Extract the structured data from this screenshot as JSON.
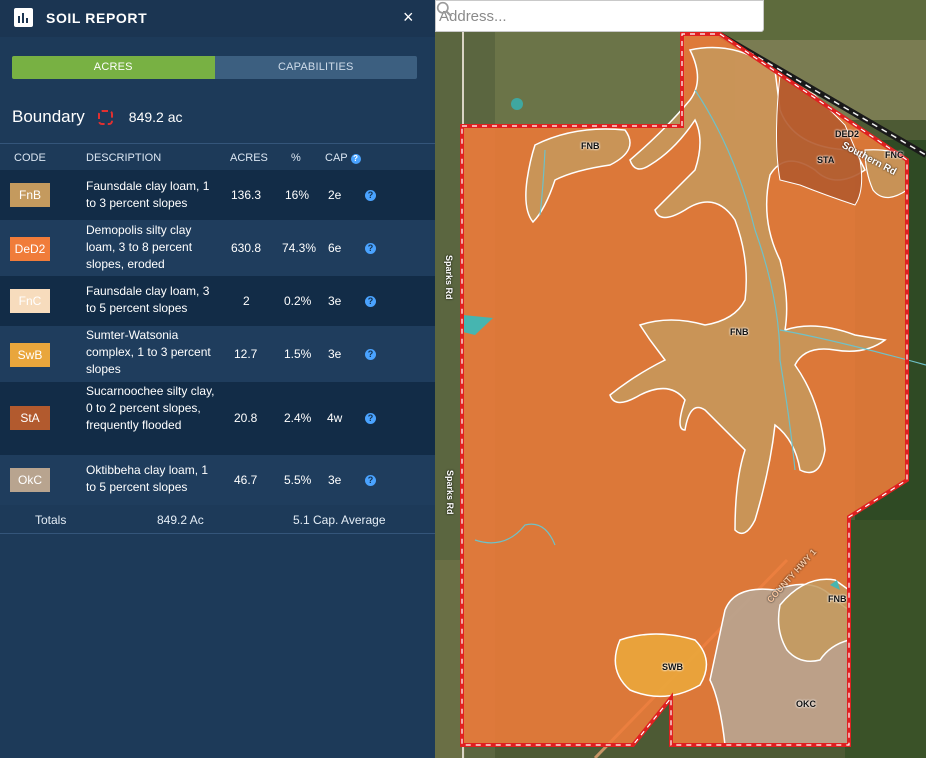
{
  "panel": {
    "title": "SOIL REPORT",
    "close": "×",
    "tabs": [
      {
        "label": "ACRES",
        "active": true
      },
      {
        "label": "CAPABILITIES",
        "active": false
      }
    ],
    "boundary": {
      "label": "Boundary",
      "acres": "849.2 ac"
    },
    "columns": {
      "code": "CODE",
      "description": "DESCRIPTION",
      "acres": "ACRES",
      "percent": "%",
      "cap": "CAP",
      "cap_info": "?"
    },
    "rows": [
      {
        "code": "FnB",
        "color": "#c49a5e",
        "description": "Faunsdale clay loam, 1 to 3 percent slopes",
        "acres": "136.3",
        "percent": "16%",
        "cap": "2e",
        "info": "?"
      },
      {
        "code": "DeD2",
        "color": "#f07c3a",
        "description": "Demopolis silty clay loam, 3 to 8 percent slopes, eroded",
        "acres": "630.8",
        "percent": "74.3%",
        "cap": "6e",
        "info": "?"
      },
      {
        "code": "FnC",
        "color": "#f7dcbd",
        "description": "Faunsdale clay loam, 3 to 5 percent slopes",
        "acres": "2",
        "percent": "0.2%",
        "cap": "3e",
        "info": "?"
      },
      {
        "code": "SwB",
        "color": "#e9a63c",
        "description": "Sumter-Watsonia complex, 1 to 3 percent slopes",
        "acres": "12.7",
        "percent": "1.5%",
        "cap": "3e",
        "info": "?"
      },
      {
        "code": "StA",
        "color": "#b25a2e",
        "description": "Sucarnoochee silty clay, 0 to 2 percent slopes, frequently flooded",
        "acres": "20.8",
        "percent": "2.4%",
        "cap": "4w",
        "info": "?"
      },
      {
        "code": "OkC",
        "color": "#b8a48f",
        "description": "Oktibbeha clay loam, 1 to 5 percent slopes",
        "acres": "46.7",
        "percent": "5.5%",
        "cap": "3e",
        "info": "?"
      }
    ],
    "totals": {
      "label": "Totals",
      "acres": "849.2 Ac",
      "cap_average": "5.1 Cap. Average"
    }
  },
  "map": {
    "search_placeholder": "Address...",
    "labels": {
      "fnb_top": "FNB",
      "fnb_center": "FNB",
      "fnb_right": "FNB",
      "ded2": "DED2",
      "sta": "STA",
      "fnc": "FNC",
      "swb": "SWB",
      "okc": "OKC"
    },
    "roads": {
      "southern": "Southern Rd",
      "sparks_top": "Sparks Rd",
      "sparks_bottom": "Sparks Rd",
      "county_hwy": "COUNTY HWY 1"
    },
    "colors": {
      "boundary": "#e02020",
      "ded2": "#f07c3a",
      "fnb": "#c49a5e",
      "okc": "#b8a48f",
      "swb": "#e9a63c",
      "sta": "#b25a2e"
    }
  }
}
